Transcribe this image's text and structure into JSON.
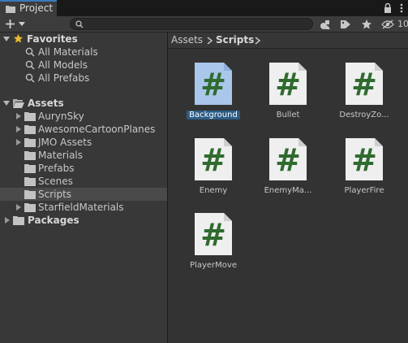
{
  "window": {
    "tab_title": "Project",
    "hidden_count": "10"
  },
  "toolbar": {
    "add_label": "+",
    "search_placeholder": ""
  },
  "favorites": {
    "label": "Favorites",
    "items": [
      {
        "label": "All Materials"
      },
      {
        "label": "All Models"
      },
      {
        "label": "All Prefabs"
      }
    ]
  },
  "assets": {
    "label": "Assets",
    "folders": [
      {
        "label": "AurynSky",
        "expandable": true
      },
      {
        "label": "AwesomeCartoonPlanes",
        "expandable": true
      },
      {
        "label": "JMO Assets",
        "expandable": true
      },
      {
        "label": "Materials",
        "expandable": false
      },
      {
        "label": "Prefabs",
        "expandable": false
      },
      {
        "label": "Scenes",
        "expandable": false
      },
      {
        "label": "Scripts",
        "expandable": false,
        "selected": true
      },
      {
        "label": "StarfieldMaterials",
        "expandable": true
      }
    ]
  },
  "packages": {
    "label": "Packages"
  },
  "breadcrumb": {
    "items": [
      "Assets",
      "Scripts"
    ]
  },
  "scripts": [
    {
      "name": "Background",
      "selected": true
    },
    {
      "name": "Bullet"
    },
    {
      "name": "DestroyZo..."
    },
    {
      "name": "Enemy"
    },
    {
      "name": "EnemyMa..."
    },
    {
      "name": "PlayerFire"
    },
    {
      "name": "PlayerMove"
    }
  ],
  "colors": {
    "accent": "#3a79bb",
    "selection": "#2c5d87",
    "script_hash": "#2f6b2f",
    "favorite_star": "#e8b830",
    "folder": "#c2c2c2"
  }
}
